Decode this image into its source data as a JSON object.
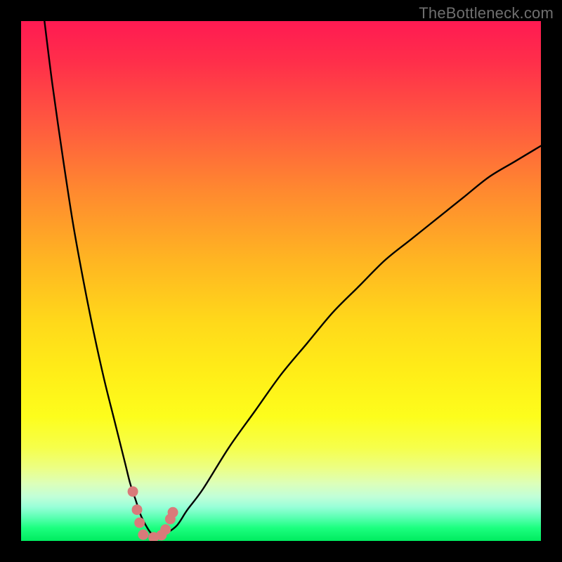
{
  "watermark": {
    "text": "TheBottleneck.com"
  },
  "colors": {
    "frame": "#000000",
    "curve": "#000000",
    "marker": "#d97a7a",
    "gradient_top": "#ff1a52",
    "gradient_bottom": "#00eb5f"
  },
  "chart_data": {
    "type": "line",
    "title": "",
    "xlabel": "",
    "ylabel": "",
    "xlim": [
      0,
      100
    ],
    "ylim": [
      0,
      100
    ],
    "grid": false,
    "legend": false,
    "series": [
      {
        "name": "bottleneck-curve",
        "x": [
          4.5,
          6,
          8,
          10,
          12,
          14,
          16,
          18,
          20,
          21,
          22,
          23,
          24,
          25,
          26,
          27,
          28,
          30,
          32,
          35,
          40,
          45,
          50,
          55,
          60,
          65,
          70,
          75,
          80,
          85,
          90,
          95,
          100
        ],
        "y": [
          100,
          88,
          74,
          61,
          50,
          40,
          31,
          23,
          15,
          11,
          8,
          5,
          3,
          1.5,
          1,
          1,
          1.5,
          3,
          6,
          10,
          18,
          25,
          32,
          38,
          44,
          49,
          54,
          58,
          62,
          66,
          70,
          73,
          76
        ]
      }
    ],
    "markers": [
      {
        "x": 21.5,
        "y": 9.5
      },
      {
        "x": 22.3,
        "y": 6.0
      },
      {
        "x": 22.8,
        "y": 3.5
      },
      {
        "x": 23.5,
        "y": 1.2
      },
      {
        "x": 25.5,
        "y": 0.7
      },
      {
        "x": 27.0,
        "y": 1.1
      },
      {
        "x": 27.8,
        "y": 2.2
      },
      {
        "x": 28.7,
        "y": 4.2
      },
      {
        "x": 29.2,
        "y": 5.5
      }
    ]
  }
}
